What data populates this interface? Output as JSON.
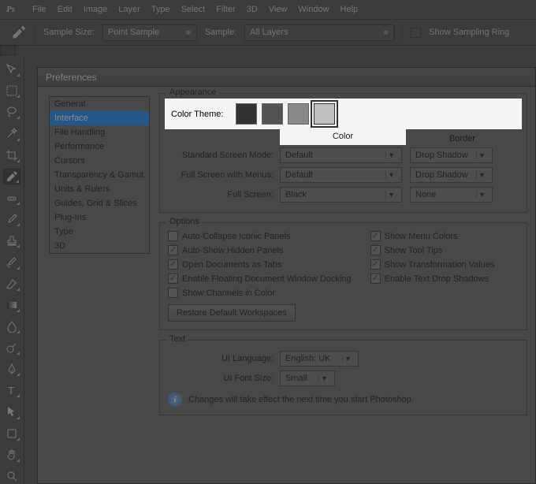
{
  "menu": {
    "items": [
      "File",
      "Edit",
      "Image",
      "Layer",
      "Type",
      "Select",
      "Filter",
      "3D",
      "View",
      "Window",
      "Help"
    ]
  },
  "options_bar": {
    "sample_size_label": "Sample Size:",
    "sample_size_value": "Point Sample",
    "sample_label": "Sample:",
    "sample_value": "All Layers",
    "show_ring": "Show Sampling Ring"
  },
  "prefs": {
    "title": "Preferences",
    "categories": [
      "General",
      "Interface",
      "File Handling",
      "Performance",
      "Cursors",
      "Transparency & Gamut",
      "Units & Rulers",
      "Guides, Grid & Slices",
      "Plug-Ins",
      "Type",
      "3D"
    ],
    "selected": "Interface",
    "appearance": {
      "legend": "Appearance",
      "color_theme_label": "Color Theme:",
      "swatches": [
        "#323232",
        "#535353",
        "#888888",
        "#c0c0c0"
      ],
      "color_hdr": "Color",
      "border_hdr": "Border",
      "rows": [
        {
          "label": "Standard Screen Mode:",
          "color": "Default",
          "border": "Drop Shadow"
        },
        {
          "label": "Full Screen with Menus:",
          "color": "Default",
          "border": "Drop Shadow"
        },
        {
          "label": "Full Screen:",
          "color": "Black",
          "border": "None"
        }
      ]
    },
    "options": {
      "legend": "Options",
      "left": [
        {
          "label": "Auto-Collapse Iconic Panels",
          "checked": false
        },
        {
          "label": "Auto-Show Hidden Panels",
          "checked": true
        },
        {
          "label": "Open Documents as Tabs",
          "checked": true
        },
        {
          "label": "Enable Floating Document Window Docking",
          "checked": true
        },
        {
          "label": "Show Channels in Color",
          "checked": false
        }
      ],
      "right": [
        {
          "label": "Show Menu Colors",
          "checked": true
        },
        {
          "label": "Show Tool Tips",
          "checked": true
        },
        {
          "label": "Show Transformation Values",
          "checked": true
        },
        {
          "label": "Enable Text Drop Shadows",
          "checked": true
        }
      ],
      "restore_btn": "Restore Default Workspaces"
    },
    "text": {
      "legend": "Text",
      "lang_label": "UI Language:",
      "lang_value": "English: UK",
      "font_label": "UI Font Size:",
      "font_value": "Small",
      "note": "Changes will take effect the next time you start Photoshop."
    }
  }
}
